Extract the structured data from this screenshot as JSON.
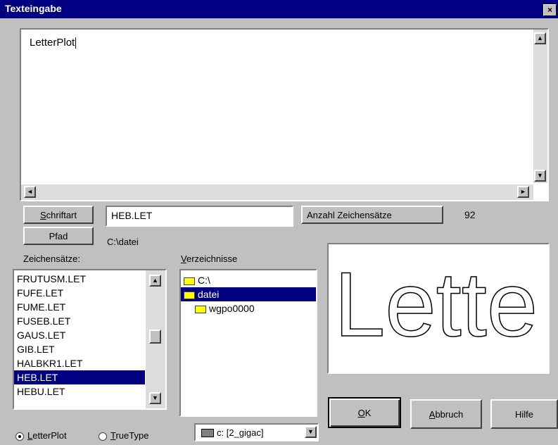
{
  "window": {
    "title": "Texteingabe",
    "close_label": "×"
  },
  "text_input": {
    "value": "LetterPlot"
  },
  "scroll": {
    "up": "▲",
    "down": "▼",
    "left": "◄",
    "right": "►"
  },
  "font_button": {
    "label_underlined": "S",
    "label_rest": "chriftart"
  },
  "font_value": "HEB.LET",
  "charset_count": {
    "label": "Anzahl Zeichensätze",
    "value": "92"
  },
  "path_button": {
    "label": "Pfad"
  },
  "path_value": "C:\\datei",
  "charsets": {
    "label": "Zeichensätze:",
    "items": [
      "FRUTUSM.LET",
      "FUFE.LET",
      "FUME.LET",
      "FUSEB.LET",
      "GAUS.LET",
      "GIB.LET",
      "HALBKR1.LET",
      "HEB.LET",
      "HEBU.LET"
    ],
    "selected": "HEB.LET"
  },
  "directories": {
    "label_underlined": "V",
    "label_rest": "erzeichnisse",
    "items": [
      {
        "name": "C:\\",
        "selected": false
      },
      {
        "name": "datei",
        "selected": true
      },
      {
        "name": "wgpo0000",
        "selected": false
      }
    ]
  },
  "preview": {
    "text": "Lette"
  },
  "buttons": {
    "ok_underlined": "O",
    "ok_rest": "K",
    "cancel_underlined": "A",
    "cancel_rest": "bbruch",
    "help": "Hilfe"
  },
  "font_type": {
    "letterplot_underlined": "L",
    "letterplot_rest": "etterPlot",
    "truetype_underlined": "T",
    "truetype_rest": "rueType",
    "selected": "LetterPlot"
  },
  "drive": {
    "value": "c: [2_gigac]"
  }
}
